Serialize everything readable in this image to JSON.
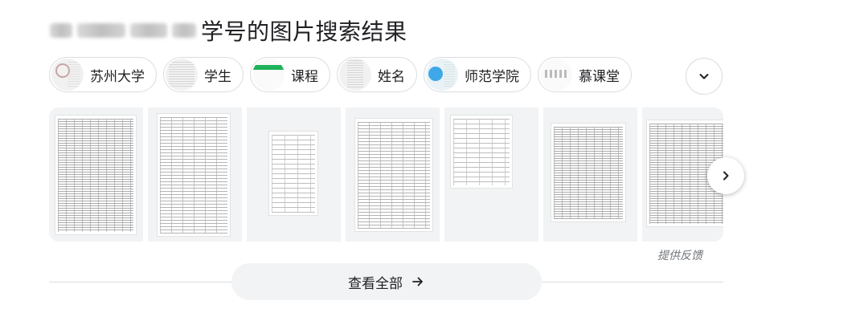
{
  "header": {
    "title": "学号的图片搜索结果"
  },
  "chips": [
    {
      "label": "苏州大学"
    },
    {
      "label": "学生"
    },
    {
      "label": "课程"
    },
    {
      "label": "姓名"
    },
    {
      "label": "师范学院"
    },
    {
      "label": "慕课堂"
    }
  ],
  "icons": {
    "expand": "chevron-down-icon",
    "next": "chevron-right-icon",
    "view_all": "arrow-right-icon"
  },
  "feedback": {
    "label": "提供反馈"
  },
  "footer": {
    "view_all_label": "查看全部"
  },
  "colors": {
    "chip_border": "#dadce0",
    "tile_bg": "#f1f3f4",
    "text_primary": "#202124",
    "text_secondary": "#70757a"
  }
}
